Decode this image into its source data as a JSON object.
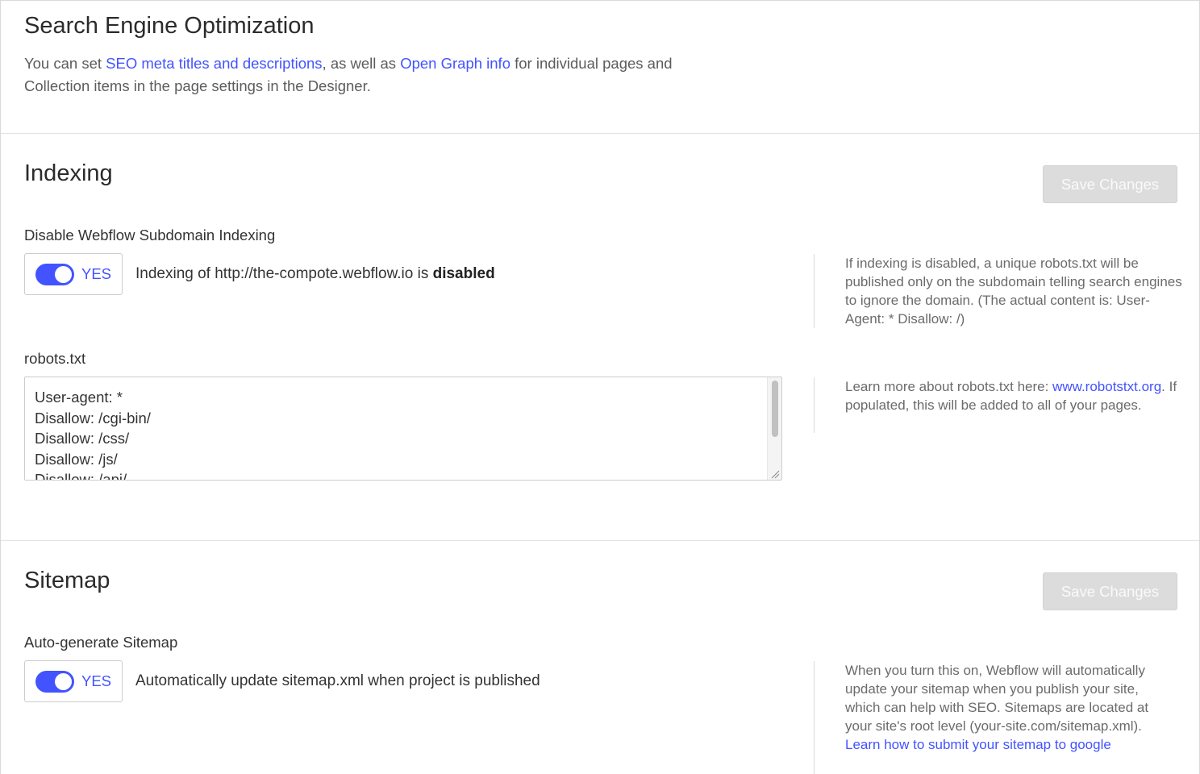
{
  "seo": {
    "title": "Search Engine Optimization",
    "intro_1": "You can set ",
    "intro_link_1": "SEO meta titles and descriptions",
    "intro_2": ", as well as ",
    "intro_link_2": "Open Graph info",
    "intro_3": " for individual pages and Collection items in the page settings in the Designer."
  },
  "indexing": {
    "title": "Indexing",
    "save_label": "Save Changes",
    "field_label": "Disable Webflow Subdomain Indexing",
    "toggle_label": "YES",
    "toggle_on": true,
    "status_prefix": "Indexing of http://the-compote.webflow.io is ",
    "status_value": "disabled",
    "help_text": "If indexing is disabled, a unique robots.txt will be published only on the subdomain telling search engines to ignore the domain. (The actual content is: User-Agent: * Disallow: /)",
    "robots_label": "robots.txt",
    "robots_content": "User-agent: *\nDisallow: /cgi-bin/\nDisallow: /css/\nDisallow: /js/\nDisallow: /api/",
    "robots_help_1": "Learn more about robots.txt here: ",
    "robots_help_link": "www.robotstxt.org",
    "robots_help_2": ". If populated, this will be added to all of your pages."
  },
  "sitemap": {
    "title": "Sitemap",
    "save_label": "Save Changes",
    "field_label": "Auto-generate Sitemap",
    "toggle_label": "YES",
    "toggle_on": true,
    "status_text": "Automatically update sitemap.xml when project is published",
    "help_text": "When you turn this on, Webflow will automatically update your sitemap when you publish your site, which can help with SEO. Sitemaps are located at your site's root level (your-site.com/sitemap.xml). ",
    "help_link": "Learn how to submit your sitemap to google"
  },
  "colors": {
    "accent": "#4353ff",
    "button_disabled_bg": "#dcdcdc",
    "text_primary": "#333333",
    "text_muted": "#6b6b6b"
  }
}
